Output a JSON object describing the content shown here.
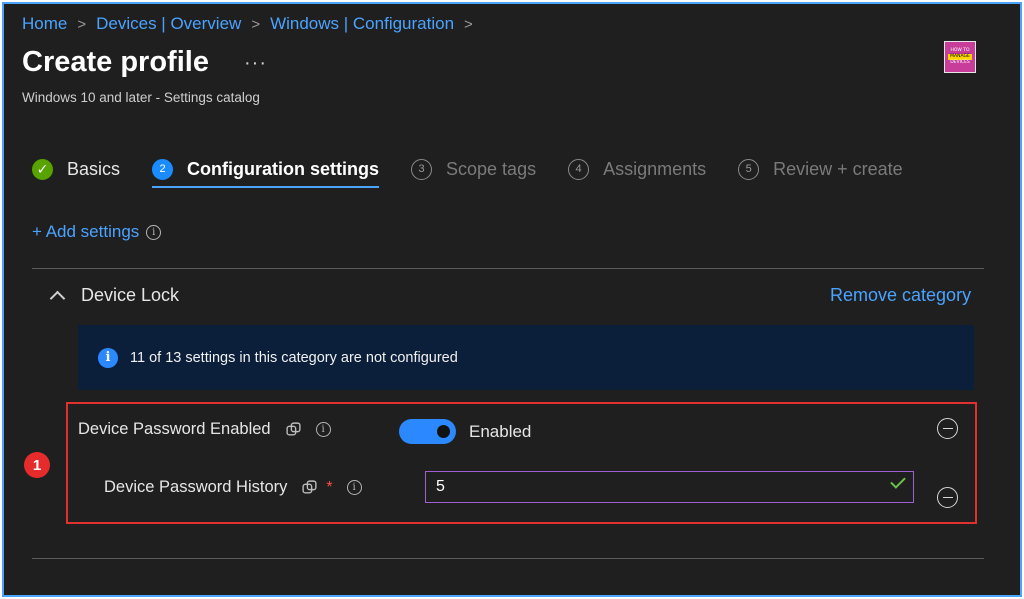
{
  "breadcrumb": [
    {
      "label": "Home"
    },
    {
      "label": "Devices | Overview"
    },
    {
      "label": "Windows | Configuration"
    }
  ],
  "header": {
    "title": "Create profile",
    "more_label": "···",
    "subtitle": "Windows 10 and later - Settings catalog",
    "logo": {
      "line1": "HOW TO",
      "line2": "MANAGE",
      "line3": "DEVICES"
    }
  },
  "wizard_steps": [
    {
      "number": "✓",
      "label": "Basics",
      "state": "done"
    },
    {
      "number": "2",
      "label": "Configuration settings",
      "state": "active"
    },
    {
      "number": "3",
      "label": "Scope tags",
      "state": "pending"
    },
    {
      "number": "4",
      "label": "Assignments",
      "state": "pending"
    },
    {
      "number": "5",
      "label": "Review + create",
      "state": "pending"
    }
  ],
  "add_settings_label": "+ Add settings",
  "category": {
    "name": "Device Lock",
    "remove_label": "Remove category",
    "banner_text": "11 of 13 settings in this category are not configured",
    "annotation_number": "1",
    "settings": [
      {
        "label": "Device Password Enabled",
        "value_label": "Enabled",
        "enabled": true
      },
      {
        "label": "Device Password History",
        "required_mark": "*",
        "value": "5"
      }
    ]
  },
  "colors": {
    "accent": "#4aa3ff",
    "background": "#1f1f1f",
    "highlight_border": "#e03030",
    "success": "#57a300"
  },
  "icons": {
    "info": "info-icon",
    "sync": "sync-icon",
    "check": "checkmark-icon",
    "remove": "minus-circle-icon"
  }
}
